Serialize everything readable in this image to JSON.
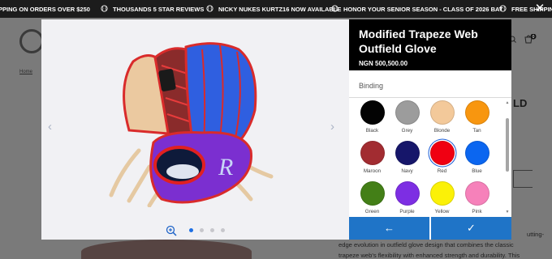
{
  "announcements": [
    "PPING ON ORDERS OVER $250",
    "THOUSANDS 5 STAR REVIEWS",
    "NICKY NUKES KURTZ16 NOW AVAILABLE",
    "HONOR YOUR SENIOR SEASON - CLASS OF 2026 BAT",
    "FREE SHIPPING"
  ],
  "background_page": {
    "breadcrumb": "Home",
    "title_fragment": "LD",
    "cart_count": "0",
    "description": [
      "utting-",
      "edge evolution in outfield glove design that combines the classic",
      "trapeze web's flexibility with enhanced strength and durability. This"
    ]
  },
  "modal": {
    "close_symbol": "✕",
    "prev_symbol": "‹",
    "next_symbol": "›",
    "slides": 4,
    "active_slide": 1,
    "product": {
      "title": "Modified Trapeze Web Outfield Glove",
      "price": "NGN 500,500.00"
    },
    "section_label": "Binding",
    "swatches": [
      {
        "name": "Black",
        "color": "#030303"
      },
      {
        "name": "Grey",
        "color": "#9c9c9c"
      },
      {
        "name": "Blonde",
        "color": "#f3c99a"
      },
      {
        "name": "Tan",
        "color": "#f8960f"
      },
      {
        "name": "Maroon",
        "color": "#a22c31"
      },
      {
        "name": "Navy",
        "color": "#16166a"
      },
      {
        "name": "Red",
        "color": "#f00012"
      },
      {
        "name": "Blue",
        "color": "#0b66f0"
      },
      {
        "name": "Green",
        "color": "#437f17"
      },
      {
        "name": "Purple",
        "color": "#7d2ee3"
      },
      {
        "name": "Yellow",
        "color": "#fbf107"
      },
      {
        "name": "Pink",
        "color": "#f681ba"
      }
    ],
    "selected_swatch": "Red",
    "back_symbol": "←",
    "confirm_symbol": "✓"
  },
  "colors": {
    "accent": "#1f74c7",
    "header_bg": "#000000",
    "announcement_bg": "#1c1c1c"
  }
}
